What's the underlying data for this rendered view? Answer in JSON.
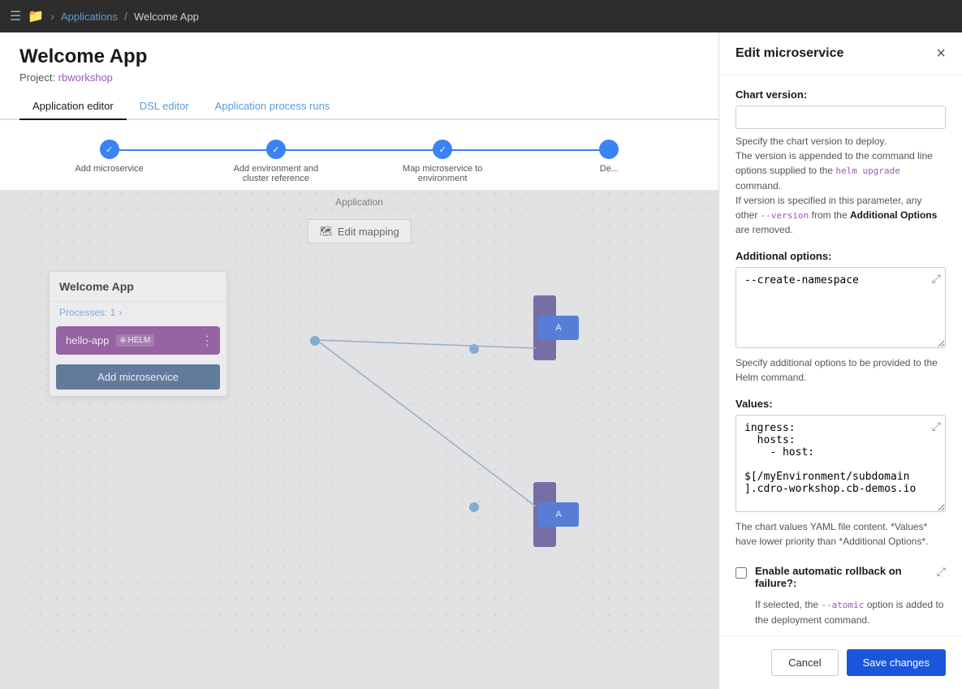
{
  "nav": {
    "breadcrumbs": [
      "Applications",
      "Welcome App"
    ],
    "separator": "/"
  },
  "page": {
    "title": "Welcome App",
    "project_label": "Project:",
    "project_name": "rbworkshop"
  },
  "tabs": [
    {
      "id": "app-editor",
      "label": "Application editor",
      "active": true
    },
    {
      "id": "dsl-editor",
      "label": "DSL editor",
      "active": false
    },
    {
      "id": "app-process-runs",
      "label": "Application process runs",
      "active": false
    }
  ],
  "progress_steps": [
    {
      "label": "Add microservice",
      "done": true
    },
    {
      "label": "Add environment and cluster reference",
      "done": true
    },
    {
      "label": "Map microservice to environment",
      "done": true
    },
    {
      "label": "De...",
      "done": false
    }
  ],
  "canvas": {
    "application_label": "Application",
    "edit_mapping_btn": "Edit mapping",
    "service_card": {
      "title": "Welcome App",
      "processes_label": "Processes: 1",
      "microservice_name": "hello-app",
      "helm_label": "HELM",
      "add_btn": "Add microservice"
    }
  },
  "edit_panel": {
    "title": "Edit microservice",
    "chart_version": {
      "label": "Chart version:",
      "value": "",
      "placeholder": ""
    },
    "chart_version_desc": [
      "Specify the chart version to deploy.",
      "The version is appended to the command line options supplied to the ",
      "helm upgrade",
      " command.",
      "If version is specified in this parameter, any other ",
      "--version",
      " from the ",
      "Additional Options",
      " are removed."
    ],
    "additional_options": {
      "label": "Additional options:",
      "value": "--create-namespace"
    },
    "additional_options_desc": "Specify additional options to be provided to the Helm command.",
    "values": {
      "label": "Values:",
      "value": "ingress:\n  hosts:\n    - host:\n      $[/myEnvironment/subdomain\n].cdro-workshop.cb-demos.io"
    },
    "values_desc": "The chart values YAML file content. *Values* have lower priority than *Additional Options*.",
    "rollback": {
      "label": "Enable automatic rollback on failure?:",
      "checked": false,
      "desc_prefix": "If selected, the ",
      "desc_code": "--atomic",
      "desc_suffix": " option is added to the deployment command."
    },
    "cancel_btn": "Cancel",
    "save_btn": "Save changes"
  }
}
